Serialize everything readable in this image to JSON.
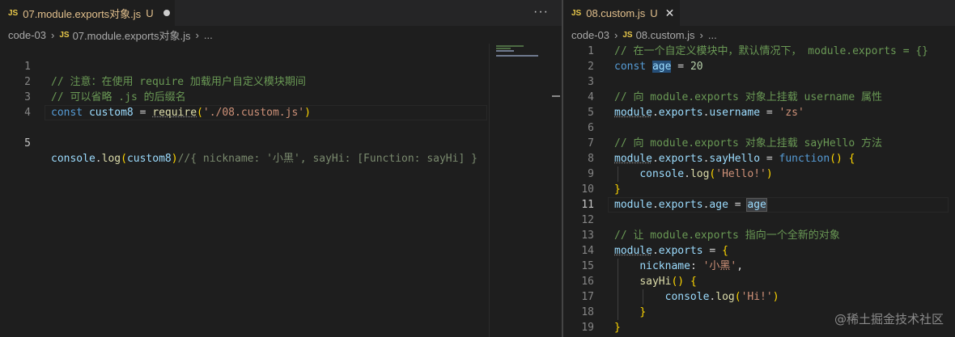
{
  "left": {
    "tab": {
      "icon": "JS",
      "name": "07.module.exports对象.js",
      "status": "U"
    },
    "breadcrumb": {
      "folder": "code-03",
      "icon": "JS",
      "file": "07.module.exports对象.js",
      "more": "..."
    },
    "more_actions": "···",
    "lines": [
      {
        "n": "1",
        "text": "// 注意：在使用 require 加载用户自定义模块期间"
      },
      {
        "n": "2",
        "text": "// 可以省略 .js 的后缀名"
      },
      {
        "n": "3",
        "text": "const custom8 = require('./08.custom.js')"
      },
      {
        "n": "4",
        "text": ""
      },
      {
        "n": "5",
        "text": "console.log(custom8)//{ nickname: '小黑', sayHi: [Function: sayHi] }"
      }
    ]
  },
  "right": {
    "tab": {
      "icon": "JS",
      "name": "08.custom.js",
      "status": "U",
      "close": "✕"
    },
    "breadcrumb": {
      "folder": "code-03",
      "icon": "JS",
      "file": "08.custom.js",
      "more": "..."
    },
    "lines": [
      {
        "n": "1",
        "text": "// 在一个自定义模块中，默认情况下， module.exports = {}"
      },
      {
        "n": "2",
        "text": "const age = 20"
      },
      {
        "n": "3",
        "text": ""
      },
      {
        "n": "4",
        "text": "// 向 module.exports 对象上挂载 username 属性"
      },
      {
        "n": "5",
        "text": "module.exports.username = 'zs'"
      },
      {
        "n": "6",
        "text": ""
      },
      {
        "n": "7",
        "text": "// 向 module.exports 对象上挂载 sayHello 方法"
      },
      {
        "n": "8",
        "text": "module.exports.sayHello = function() {"
      },
      {
        "n": "9",
        "text": "    console.log('Hello!')"
      },
      {
        "n": "10",
        "text": "}"
      },
      {
        "n": "11",
        "text": "module.exports.age = age"
      },
      {
        "n": "12",
        "text": ""
      },
      {
        "n": "13",
        "text": "// 让 module.exports 指向一个全新的对象"
      },
      {
        "n": "14",
        "text": "module.exports = {"
      },
      {
        "n": "15",
        "text": "    nickname: '小黑',"
      },
      {
        "n": "16",
        "text": "    sayHi() {"
      },
      {
        "n": "17",
        "text": "        console.log('Hi!')"
      },
      {
        "n": "18",
        "text": "    }"
      },
      {
        "n": "19",
        "text": "}"
      }
    ]
  },
  "watermark": "@稀土掘金技术社区",
  "colors": {
    "comment": "#6a9955",
    "keyword": "#569cd6",
    "variable": "#9cdcfe",
    "function": "#dcdcaa",
    "string": "#ce9178",
    "number": "#b5cea8",
    "modified": "#e2c08d"
  }
}
